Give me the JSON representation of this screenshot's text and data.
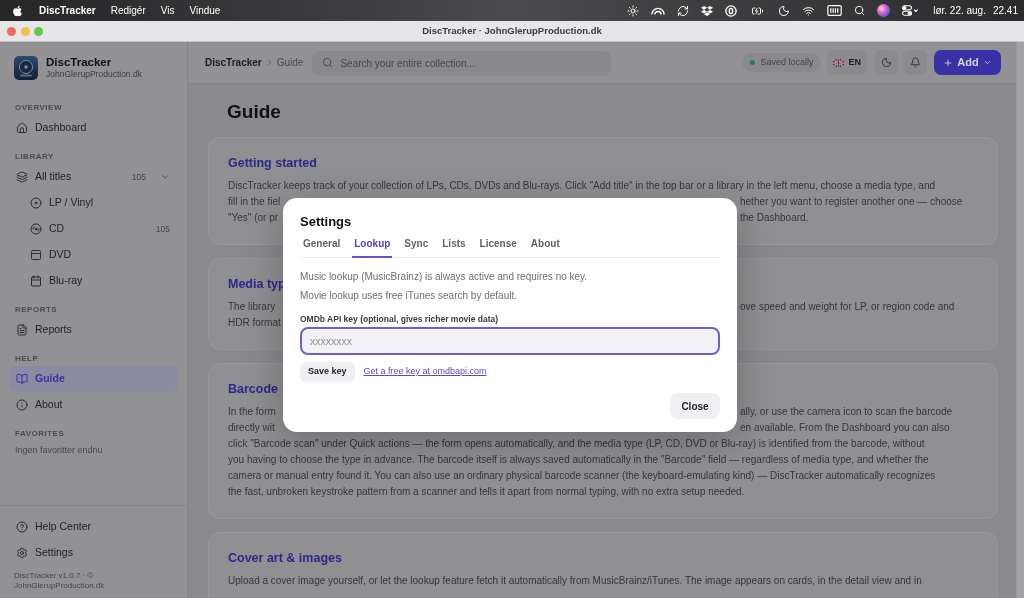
{
  "menu_bar": {
    "app_name": "DiscTracker",
    "menus": [
      "Redigér",
      "Vis",
      "Vindue"
    ],
    "date": "lør. 22. aug.",
    "time": "22.41"
  },
  "window": {
    "title": "DiscTracker · JohnGlerupProduction.dk"
  },
  "sidebar": {
    "app_name": "DiscTracker",
    "app_subtitle": "JohnGlerupProduction.dk",
    "sections": [
      {
        "label": "OVERVIEW",
        "items": [
          {
            "kind": "home",
            "label": "Dashboard",
            "selected": false
          }
        ]
      },
      {
        "label": "LIBRARY",
        "items": [
          {
            "kind": "layers",
            "label": "All titles",
            "count": "105",
            "expanded": true,
            "selected": false,
            "children": [
              {
                "kind": "vinyl",
                "label": "LP / Vinyl",
                "selected": false
              },
              {
                "kind": "cd",
                "label": "CD",
                "count": "105",
                "selected": false
              },
              {
                "kind": "dvd",
                "label": "DVD",
                "selected": false
              },
              {
                "kind": "bluray",
                "label": "Blu-ray",
                "selected": false
              }
            ]
          }
        ]
      },
      {
        "label": "REPORTS",
        "items": [
          {
            "kind": "report",
            "label": "Reports",
            "selected": false
          }
        ]
      },
      {
        "label": "HELP",
        "items": [
          {
            "kind": "guide",
            "label": "Guide",
            "selected": true
          },
          {
            "kind": "about",
            "label": "About",
            "selected": false
          }
        ]
      },
      {
        "label": "FAVORITES",
        "empty_text": "Ingen favoritter endnu"
      }
    ],
    "footer_items": [
      {
        "kind": "help",
        "label": "Help Center",
        "selected": false
      },
      {
        "kind": "settings",
        "label": "Settings",
        "selected": false
      }
    ],
    "footer_text": "DiscTracker v1.0.7 · © JohnGlerupProduction.dk"
  },
  "topbar": {
    "breadcrumb": [
      "DiscTracker",
      "Guide"
    ],
    "search": {
      "placeholder": "Search your entire collection..."
    },
    "save_status": "Saved locally",
    "language": "EN",
    "add_button": "Add"
  },
  "page": {
    "title": "Guide",
    "sections": [
      {
        "heading": "Getting started",
        "lines": [
          {
            "kind": "full",
            "text": "DiscTracker keeps track of your collection of LPs, CDs, DVDs and Blu-rays. Click \"Add title\" in the top bar or a library in the left menu, choose a media type, and"
          },
          {
            "kind": "split",
            "left": "fill in the fiel",
            "right": "hether you want to register another one — choose"
          },
          {
            "kind": "split",
            "left": "\"Yes\" (or pr",
            "right": "the Dashboard."
          }
        ]
      },
      {
        "heading": "Media typ",
        "lines": [
          {
            "kind": "split",
            "left": "The library",
            "right": "ove speed and weight for LP, or region code and"
          },
          {
            "kind": "split",
            "left": "HDR format"
          }
        ]
      },
      {
        "heading": "Barcode",
        "lines": [
          {
            "kind": "split",
            "left": "In the form",
            "right": "ally, or use the camera icon to scan the barcode"
          },
          {
            "kind": "split",
            "left": "directly wit",
            "right": "en available. From the Dashboard you can also"
          },
          {
            "kind": "full",
            "text": "click \"Barcode scan\" under Quick actions — the form opens automatically, and the media type (LP, CD, DVD or Blu-ray) is identified from the barcode, without"
          },
          {
            "kind": "full",
            "text": "you having to choose the type in advance. The barcode itself is always saved automatically in the \"Barcode\" field — regardless of media type, and whether the"
          },
          {
            "kind": "full",
            "text": "camera or manual entry found it. You can also use an ordinary physical barcode scanner (the keyboard-emulating kind) — DiscTracker automatically recognizes"
          },
          {
            "kind": "full",
            "text": "the fast, unbroken keystroke pattern from a scanner and tells it apart from normal typing, with no extra setup needed."
          }
        ]
      },
      {
        "heading": "Cover art & images",
        "lines": [
          {
            "kind": "full",
            "text": "Upload a cover image yourself, or let the lookup feature fetch it automatically from MusicBrainz/iTunes. The image appears on cards, in the detail view and in"
          }
        ]
      }
    ]
  },
  "settings_dialog": {
    "title": "Settings",
    "tabs": [
      {
        "label": "General",
        "selected": false
      },
      {
        "label": "Lookup",
        "selected": true
      },
      {
        "label": "Sync",
        "selected": false
      },
      {
        "label": "Lists",
        "selected": false
      },
      {
        "label": "License",
        "selected": false
      },
      {
        "label": "About",
        "selected": false
      }
    ],
    "notes": [
      "Music lookup (MusicBrainz) is always active and requires no key.",
      "Movie lookup uses free iTunes search by default."
    ],
    "api_key_field": {
      "label": "OMDb API key (optional, gives richer movie data)",
      "placeholder": "xxxxxxxx",
      "focused": true
    },
    "save_button": "Save key",
    "link": "Get a free key at omdbapi.com",
    "close_button": "Close"
  }
}
